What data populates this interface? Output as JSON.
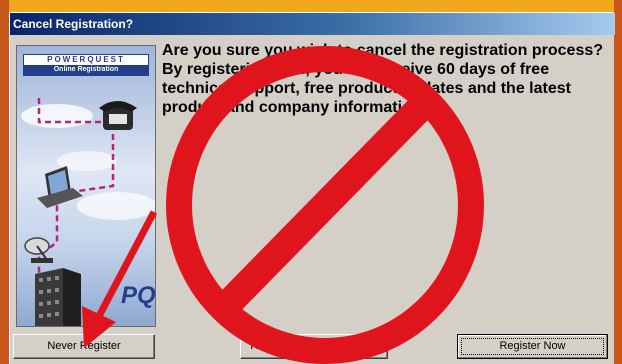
{
  "dialog": {
    "title": "Cancel Registration?",
    "message": "Are you sure you wish to cancel the registration process? By registering now, you will receive 60 days of free technical support, free product updates and the latest product and company information."
  },
  "branding": {
    "name": "POWERQUEST",
    "subtitle": "Online Registration",
    "logo": "PQ"
  },
  "buttons": {
    "never": "Never Register",
    "remind": "Remind Me in Two Weeks",
    "register": "Register Now"
  },
  "annotation": {
    "symbol": "prohibition-sign",
    "color": "#e0141d"
  },
  "colors": {
    "dialog_bg": "#d4d0c8",
    "titlebar": "#0a246a",
    "backdrop_orange": "#c8571a",
    "backdrop_yellow": "#f2a81d"
  }
}
